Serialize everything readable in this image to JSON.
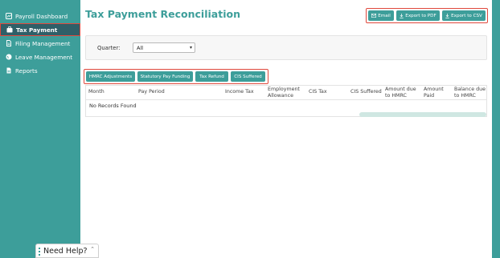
{
  "sidebar": {
    "items": [
      {
        "label": "Payroll Dashboard",
        "icon": "dashboard-icon"
      },
      {
        "label": "Tax Payment",
        "icon": "briefcase-icon",
        "active": true
      },
      {
        "label": "Filing Management",
        "icon": "document-icon"
      },
      {
        "label": "Leave Management",
        "icon": "globe-icon"
      },
      {
        "label": "Reports",
        "icon": "report-icon"
      }
    ]
  },
  "page": {
    "title": "Tax Payment Reconciliation"
  },
  "toolbar": {
    "email_label": "Email",
    "export_pdf_label": "Export to PDF",
    "export_csv_label": "Export to CSV"
  },
  "filter": {
    "label": "Quarter:",
    "selected": "All"
  },
  "tabs": [
    "HMRC Adjustments",
    "Statutory Pay Funding",
    "Tax Refund",
    "CIS Suffered"
  ],
  "table": {
    "columns": [
      "Month",
      "Pay Period",
      "Income Tax",
      "Employment Allowance",
      "CIS Tax",
      "CIS Suffered",
      "Amount due to HMRC",
      "Amount Paid",
      "Balance due to HMRC"
    ],
    "empty_message": "No Records Found"
  },
  "help": {
    "label": "Need Help?"
  },
  "colors": {
    "accent": "#3d9e9a",
    "sidebar_active": "#2f5f68",
    "highlight_border": "#e0483c"
  }
}
